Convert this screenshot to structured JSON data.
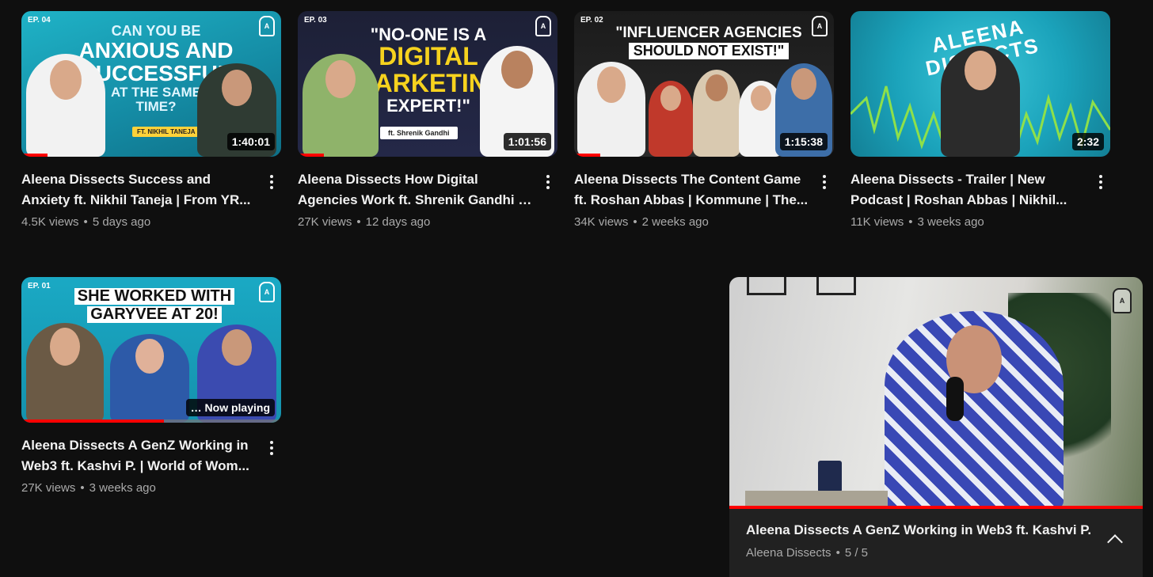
{
  "videos": [
    {
      "episode": "EP. 04",
      "headline": [
        "CAN YOU BE",
        "ANXIOUS AND",
        "SUCCESSFUL",
        "AT THE SAME",
        "TIME?"
      ],
      "guest_tag": "FT. NIKHIL TANEJA",
      "duration": "1:40:01",
      "title_line1": "Aleena Dissects Success and",
      "title_line2": "Anxiety ft. Nikhil Taneja | From YR...",
      "views": "4.5K views",
      "age": "5 days ago",
      "watched_fraction": 0.1
    },
    {
      "episode": "EP. 03",
      "headline": [
        "\"NO-ONE IS A",
        "DIGITAL",
        "MARKETING",
        "EXPERT!\""
      ],
      "guest_tag": "ft. Shrenik Gandhi",
      "duration": "1:01:56",
      "title_line1": "Aleena Dissects How Digital",
      "title_line2": "Agencies Work ft. Shrenik Gandhi |...",
      "views": "27K views",
      "age": "12 days ago",
      "watched_fraction": 0.1
    },
    {
      "episode": "EP. 02",
      "headline": [
        "\"INFLUENCER AGENCIES",
        "SHOULD NOT EXIST!\""
      ],
      "guest_tag": "",
      "duration": "1:15:38",
      "title_line1": "Aleena Dissects The Content Game",
      "title_line2": "ft. Roshan Abbas | Kommune | The...",
      "views": "34K views",
      "age": "2 weeks ago",
      "watched_fraction": 0.1
    },
    {
      "episode": "",
      "headline": [
        "ALEENA DISSECTS"
      ],
      "guest_tag": "",
      "duration": "2:32",
      "title_line1": "Aleena Dissects - Trailer | New",
      "title_line2": "Podcast | Roshan Abbas | Nikhil...",
      "views": "11K views",
      "age": "3 weeks ago",
      "watched_fraction": 0
    },
    {
      "episode": "EP. 01",
      "headline": [
        "SHE WORKED WITH",
        "GARYVEE AT 20!"
      ],
      "guest_tag": "",
      "duration": "",
      "now_playing": "Now playing",
      "title_line1": "Aleena Dissects A GenZ Working in",
      "title_line2": "Web3 ft. Kashvi P. | World of Wom...",
      "views": "27K views",
      "age": "3 weeks ago",
      "watched_fraction": 0.55
    }
  ],
  "miniplayer": {
    "title": "Aleena Dissects A GenZ Working in Web3 ft. Kashvi P.",
    "channel": "Aleena Dissects",
    "position": "5 / 5"
  },
  "icons": {
    "menu": "more-vert-icon",
    "expand": "chevron-up-icon",
    "channel_logo": "podcast-mic-logo"
  },
  "colors": {
    "background": "#0f0f0f",
    "progress": "#ff0000",
    "secondary_text": "#aaaaaa"
  }
}
